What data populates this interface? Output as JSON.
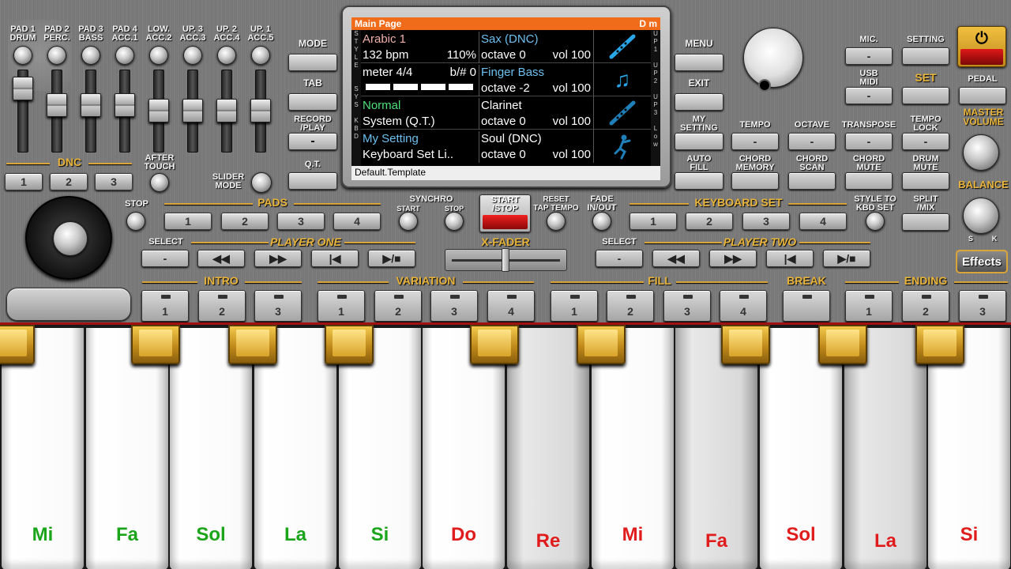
{
  "pads": {
    "labels": [
      "PAD 1\nDRUM",
      "PAD 2\nPERC.",
      "PAD 3\nBASS",
      "PAD 4\nACC.1",
      "LOW.\nACC.2",
      "UP. 3\nACC.3",
      "UP. 2\nACC.4",
      "UP. 1\nACC.5"
    ]
  },
  "dnc": {
    "title": "DNC",
    "buttons": [
      "1",
      "2",
      "3"
    ],
    "after_touch": "AFTER\nTOUCH",
    "slider_mode": "SLIDER\nMODE"
  },
  "left_menu": {
    "mode": "MODE",
    "tab": "TAB",
    "record_play": "RECORD\n/PLAY",
    "record_value": "-",
    "qt": "Q.T."
  },
  "screen": {
    "header_left": "Main Page",
    "header_right": "D m",
    "side_left": [
      "S",
      "T",
      "Y",
      "L",
      "E",
      "",
      "",
      "S",
      "Y",
      "S",
      "",
      "K",
      "B",
      "D"
    ],
    "side_right": [
      "U",
      "P",
      "1",
      "",
      "U",
      "P",
      "2",
      "",
      "U",
      "P",
      "3",
      "",
      "L",
      "o",
      "w"
    ],
    "rows": [
      {
        "left1": "Arabic 1",
        "left2": "132 bpm",
        "left2b": "110%",
        "mid1": "Sax (DNC)",
        "mid2": "octave  0",
        "mid2b": "vol 100",
        "icon": "flute-icon"
      },
      {
        "left1": "meter 4/4",
        "left1b": "b/#  0",
        "left2": "",
        "mid1": "Finger Bass",
        "mid2": "octave -2",
        "mid2b": "vol 100",
        "icon": "music-note-icon"
      },
      {
        "left1": "Normal",
        "left2": "System (Q.T.)",
        "mid1": "Clarinet",
        "mid2": "octave  0",
        "mid2b": "vol 100",
        "icon": "flute-icon"
      },
      {
        "left1": "My Setting",
        "left2": "Keyboard Set Li..",
        "mid1": "Soul (DNC)",
        "mid2": "octave  0",
        "mid2b": "vol 100",
        "icon": "dancer-icon"
      }
    ],
    "footer": "Default.Template"
  },
  "right_menu": {
    "menu": "MENU",
    "exit": "EXIT",
    "my_setting": "MY\nSETTING",
    "auto_fill": "AUTO\nFILL"
  },
  "top_right": {
    "mic": "MIC.",
    "mic_value": "-",
    "setting": "SETTING",
    "usb_midi": "USB\nMIDI",
    "usb_value": "-",
    "set": "SET",
    "pedal": "PEDAL",
    "master_volume": "MASTER\nVOLUME",
    "balance": "BALANCE",
    "balance_left": "S",
    "balance_right": "K",
    "tempo": "TEMPO",
    "octave": "OCTAVE",
    "transpose": "TRANSPOSE",
    "tempo_lock": "TEMPO\nLOCK",
    "chord_memory": "CHORD\nMEMORY",
    "chord_scan": "CHORD\nSCAN",
    "chord_mute": "CHORD\nMUTE",
    "drum_mute": "DRUM\nMUTE",
    "effects": "Effects",
    "dash": "-"
  },
  "pads_row": {
    "stop": "STOP",
    "title": "PADS",
    "buttons": [
      "1",
      "2",
      "3",
      "4"
    ]
  },
  "sync": {
    "title": "SYNCHRO",
    "start": "START",
    "stop": "STOP",
    "start_stop": "START\n/STOP",
    "reset": "RESET\nTAP TEMPO",
    "fade": "FADE\nIN/OUT"
  },
  "keyboard_set": {
    "title": "KEYBOARD SET",
    "buttons": [
      "1",
      "2",
      "3",
      "4"
    ],
    "style_to_kbd": "STYLE TO\nKBD SET",
    "split_mix": "SPLIT\n/MIX"
  },
  "player_one": {
    "select": "SELECT",
    "title": "PLAYER ONE",
    "select_value": "-"
  },
  "player_two": {
    "select": "SELECT",
    "title": "PLAYER TWO",
    "select_value": "-"
  },
  "xfader": {
    "title": "X-FADER"
  },
  "sections": {
    "intro": {
      "title": "INTRO",
      "buttons": [
        "1",
        "2",
        "3"
      ]
    },
    "variation": {
      "title": "VARIATION",
      "buttons": [
        "1",
        "2",
        "3",
        "4"
      ]
    },
    "fill": {
      "title": "FILL",
      "buttons": [
        "1",
        "2",
        "3",
        "4"
      ]
    },
    "break": {
      "title": "BREAK"
    },
    "ending": {
      "title": "ENDING",
      "buttons": [
        "1",
        "2",
        "3"
      ]
    }
  },
  "keys": {
    "white": [
      {
        "label": "Mi",
        "color": "#1aa51a"
      },
      {
        "label": "Fa",
        "color": "#1aa51a"
      },
      {
        "label": "Sol",
        "color": "#1aa51a"
      },
      {
        "label": "La",
        "color": "#1aa51a"
      },
      {
        "label": "Si",
        "color": "#1aa51a"
      },
      {
        "label": "Do",
        "color": "#e01c1c"
      },
      {
        "label": "Re",
        "color": "#e01c1c"
      },
      {
        "label": "Mi",
        "color": "#e01c1c"
      },
      {
        "label": "Fa",
        "color": "#e01c1c"
      },
      {
        "label": "Sol",
        "color": "#e01c1c"
      },
      {
        "label": "La",
        "color": "#e01c1c"
      },
      {
        "label": "Si",
        "color": "#e01c1c"
      }
    ]
  },
  "colors": {
    "accent_gold": "#e8b339",
    "screen_header": "#f06b1a",
    "red_button": "#c8101a"
  }
}
